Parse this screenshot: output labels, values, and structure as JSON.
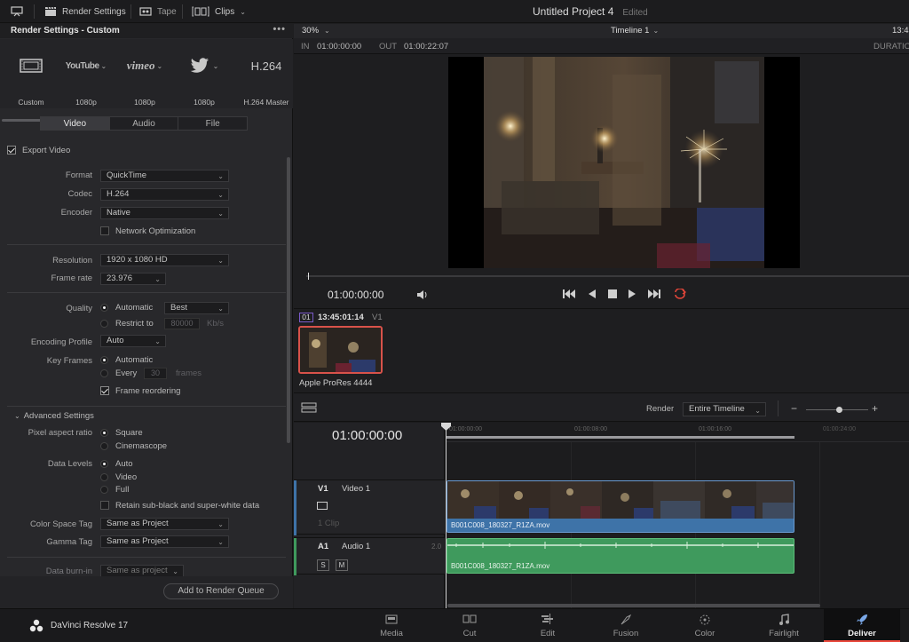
{
  "topbar": {
    "render_settings": "Render Settings",
    "tape": "Tape",
    "clips": "Clips",
    "project_title": "Untitled Project 4",
    "project_status": "Edited"
  },
  "render_panel": {
    "header": "Render Settings - Custom",
    "presets": [
      {
        "logo": "",
        "label": "Custom"
      },
      {
        "logo": "YouTube",
        "label": "1080p"
      },
      {
        "logo": "vimeo",
        "label": "1080p"
      },
      {
        "logo": "",
        "label": "1080p"
      },
      {
        "logo": "H.264",
        "label": "H.264 Master"
      }
    ],
    "tabs": [
      "Video",
      "Audio",
      "File"
    ],
    "export_video": "Export Video",
    "format_label": "Format",
    "format_value": "QuickTime",
    "codec_label": "Codec",
    "codec_value": "H.264",
    "encoder_label": "Encoder",
    "encoder_value": "Native",
    "network_opt": "Network Optimization",
    "resolution_label": "Resolution",
    "resolution_value": "1920 x 1080 HD",
    "framerate_label": "Frame rate",
    "framerate_value": "23.976",
    "quality_label": "Quality",
    "quality_automatic": "Automatic",
    "quality_value": "Best",
    "restrict_to": "Restrict to",
    "restrict_value": "80000",
    "restrict_unit": "Kb/s",
    "encoding_profile_label": "Encoding Profile",
    "encoding_profile_value": "Auto",
    "key_frames_label": "Key Frames",
    "key_frames_automatic": "Automatic",
    "key_frames_every": "Every",
    "key_frames_value": "30",
    "key_frames_unit": "frames",
    "frame_reordering": "Frame reordering",
    "advanced_settings": "Advanced Settings",
    "pixel_aspect_label": "Pixel aspect ratio",
    "pixel_square": "Square",
    "pixel_cinemascope": "Cinemascope",
    "data_levels_label": "Data Levels",
    "dl_auto": "Auto",
    "dl_video": "Video",
    "dl_full": "Full",
    "retain_subblack": "Retain sub-black and super-white data",
    "color_space_label": "Color Space Tag",
    "color_space_value": "Same as Project",
    "gamma_label": "Gamma Tag",
    "gamma_value": "Same as Project",
    "data_burnin_label": "Data burn-in",
    "data_burnin_value": "Same as project",
    "add_queue": "Add to Render Queue"
  },
  "viewer": {
    "zoom": "30%",
    "timeline_name": "Timeline 1",
    "timecode_right": "13:4",
    "in_label": "IN",
    "in_value": "01:00:00:00",
    "out_label": "OUT",
    "out_value": "01:00:22:07",
    "duration_label": "DURATIO",
    "current_tc": "01:00:00:00"
  },
  "clipbin": {
    "clip_index": "01",
    "clip_tc": "13:45:01:14",
    "clip_track": "V1",
    "clip_name": "Apple ProRes 4444"
  },
  "timeline": {
    "render_label": "Render",
    "render_value": "Entire Timeline",
    "timecode": "01:00:00:00",
    "ruler": [
      "01:00:00:00",
      "01:00:08:00",
      "01:00:16:00",
      "01:00:24:00"
    ],
    "v1_id": "V1",
    "v1_name": "Video 1",
    "v1_clips": "1 Clip",
    "v1_clip_name": "B001C008_180327_R1ZA.mov",
    "a1_id": "A1",
    "a1_name": "Audio 1",
    "a1_channels": "2.0",
    "a1_solo": "S",
    "a1_mute": "M",
    "a1_clip_name": "B001C008_180327_R1ZA.mov"
  },
  "footer": {
    "app_name": "DaVinci Resolve 17",
    "pages": [
      "Media",
      "Cut",
      "Edit",
      "Fusion",
      "Color",
      "Fairlight",
      "Deliver"
    ],
    "active_page": "Deliver"
  },
  "colors": {
    "accent": "#e9473a",
    "video_clip": "#3e73a8",
    "audio_clip": "#3f9a5d"
  }
}
